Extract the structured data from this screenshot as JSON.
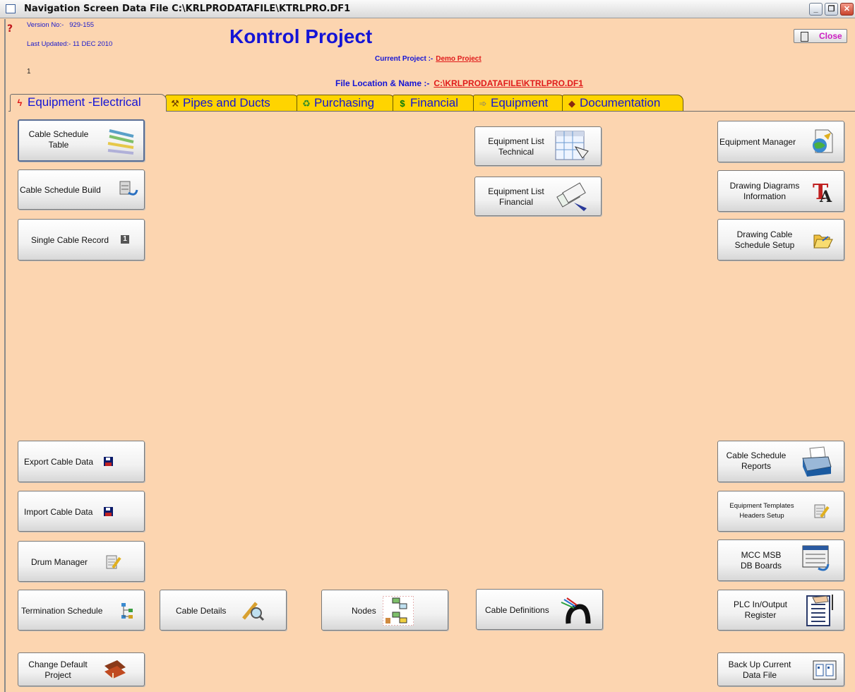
{
  "window": {
    "title": "Navigation Screen Data File C:\\KRLPRODATAFILE\\KTRLPRO.DF1",
    "minimize": "_",
    "maximize": "❐",
    "close": "✕"
  },
  "header": {
    "version_label": "Version No:-",
    "version_value": "929-155",
    "updated_label": "Last Updated:-",
    "updated_value": "11 DEC 2010",
    "page_number": "1",
    "app_title": "Kontrol Project",
    "current_project_label": "Current Project :-",
    "current_project_value": "Demo Project",
    "file_location_label": "File Location & Name :-",
    "file_location_value": "C:\\KRLPRODATAFILE\\KTRLPRO.DF1",
    "close_button": "Close"
  },
  "tabs": [
    {
      "label": "Equipment -Electrical",
      "icon": "lightning-icon",
      "active": true
    },
    {
      "label": "Pipes and Ducts",
      "icon": "pipe-icon",
      "active": false
    },
    {
      "label": "Purchasing",
      "icon": "cart-icon",
      "active": false
    },
    {
      "label": "Financial",
      "icon": "dollar-icon",
      "active": false
    },
    {
      "label": "Equipment",
      "icon": "equipment-icon",
      "active": false
    },
    {
      "label": "Documentation",
      "icon": "book-icon",
      "active": false
    }
  ],
  "buttons": {
    "cable_schedule_table": "Cable Schedule\nTable",
    "cable_schedule_build": "Cable Schedule Build",
    "single_cable_record": "Single Cable Record",
    "export_cable_data": "Export Cable Data",
    "import_cable_data": "Import Cable Data",
    "drum_manager": "Drum Manager",
    "termination_schedule": "Termination Schedule",
    "change_default_project": "Change Default\nProject",
    "cable_details": "Cable Details",
    "nodes": "Nodes",
    "cable_definitions": "Cable Definitions",
    "equipment_list_technical": "Equipment List\nTechnical",
    "equipment_list_financial": "Equipment List\nFinancial",
    "equipment_manager": "Equipment Manager",
    "drawing_diagrams_information": "Drawing Diagrams\nInformation",
    "drawing_cable_schedule_setup": "Drawing Cable\nSchedule Setup",
    "cable_schedule_reports": "Cable Schedule\nReports",
    "equipment_templates_headers_setup": "Equipment Templates\nHeaders Setup",
    "mcc_msb_db_boards": "MCC MSB\nDB Boards",
    "plc_in_output_register": "PLC In/Output\nRegister",
    "back_up_current_data_file": "Back Up Current\nData File",
    "single_record_badge": "1"
  },
  "colors": {
    "background": "#fcd5b0",
    "tab_yellow": "#ffd400",
    "title_blue": "#1414d6",
    "link_red": "#e01a1a",
    "close_magenta": "#cc1ec2"
  }
}
